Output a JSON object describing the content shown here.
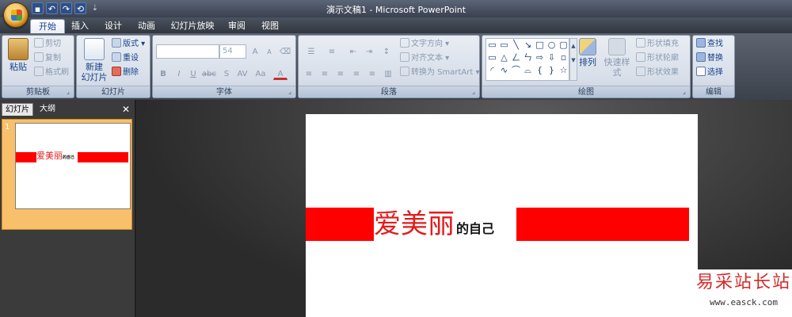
{
  "app": {
    "window_title": "演示文稿1 - Microsoft PowerPoint",
    "qat_more": "⇣"
  },
  "tabs": [
    {
      "label": "开始"
    },
    {
      "label": "插入"
    },
    {
      "label": "设计"
    },
    {
      "label": "动画"
    },
    {
      "label": "幻灯片放映"
    },
    {
      "label": "审阅"
    },
    {
      "label": "视图"
    }
  ],
  "ribbon": {
    "clipboard": {
      "label": "剪贴板",
      "paste": "粘贴",
      "cut": "剪切",
      "copy": "复制",
      "format_painter": "格式刷"
    },
    "slides": {
      "label": "幻灯片",
      "new_slide": "新建",
      "new_slide2": "幻灯片",
      "layout": "版式",
      "reset": "重设",
      "delete": "删除"
    },
    "font": {
      "label": "字体",
      "font_name": "",
      "font_size": "54",
      "bold": "B",
      "italic": "I",
      "underline": "U",
      "strike": "abc",
      "shadow": "S",
      "spacing": "AV",
      "case": "Aa",
      "color": "A",
      "grow": "A",
      "shrink": "A"
    },
    "paragraph": {
      "label": "段落",
      "text_direction": "文字方向",
      "align_text": "对齐文本",
      "smartart": "转换为 SmartArt"
    },
    "drawing": {
      "label": "绘图",
      "arrange": "排列",
      "quick_styles": "快速样式",
      "shape_fill": "形状填充",
      "shape_outline": "形状轮廓",
      "shape_effects": "形状效果"
    },
    "editing": {
      "label": "编辑",
      "find": "查找",
      "replace": "替换",
      "select": "选择"
    }
  },
  "pane": {
    "tab_slides": "幻灯片",
    "tab_outline": "大纲",
    "close": "✕",
    "slide_number": "1"
  },
  "slide": {
    "title_main": "爱美丽",
    "title_rest": "的自己",
    "accent_color": "#ff0000"
  },
  "watermark": {
    "line1": "易采站长站",
    "line2": "www.easck.com"
  }
}
